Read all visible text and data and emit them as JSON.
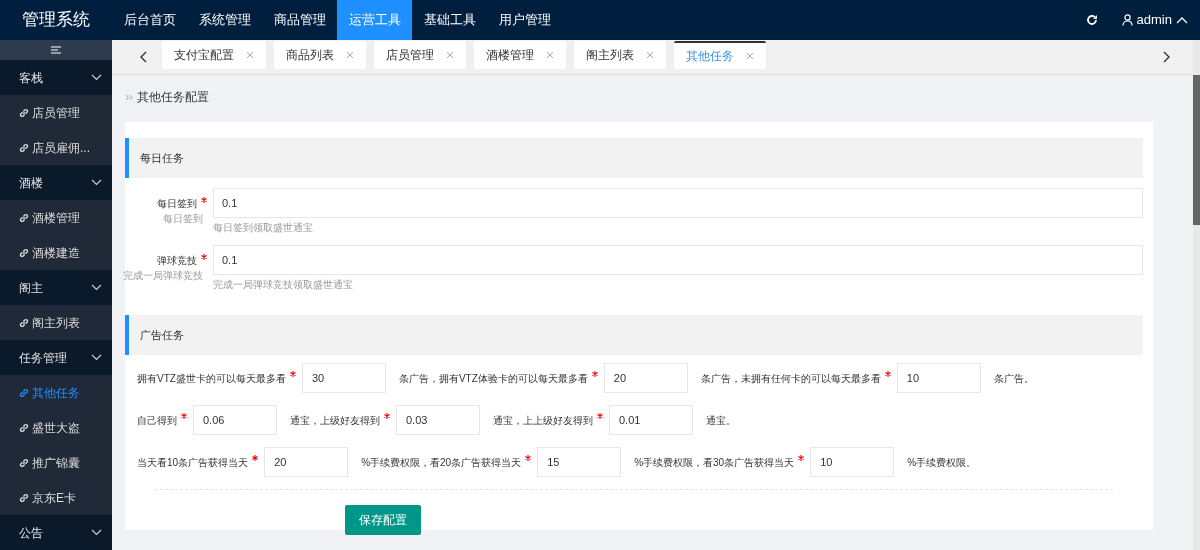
{
  "header": {
    "logo": "管理系统",
    "nav": [
      {
        "label": "后台首页",
        "selected": false
      },
      {
        "label": "系统管理",
        "selected": false
      },
      {
        "label": "商品管理",
        "selected": false
      },
      {
        "label": "运营工具",
        "selected": true
      },
      {
        "label": "基础工具",
        "selected": false
      },
      {
        "label": "用户管理",
        "selected": false
      }
    ],
    "user": "admin"
  },
  "sidebar": {
    "groups": [
      {
        "label": "客栈",
        "items": [
          {
            "label": "店员管理",
            "selected": false
          },
          {
            "label": "店员雇佣...",
            "selected": false
          }
        ]
      },
      {
        "label": "酒楼",
        "items": [
          {
            "label": "酒楼管理",
            "selected": false
          },
          {
            "label": "酒楼建造",
            "selected": false
          }
        ]
      },
      {
        "label": "阁主",
        "items": [
          {
            "label": "阁主列表",
            "selected": false
          }
        ]
      },
      {
        "label": "任务管理",
        "items": [
          {
            "label": "其他任务",
            "selected": true
          },
          {
            "label": "盛世大盗",
            "selected": false
          },
          {
            "label": "推广锦囊",
            "selected": false
          },
          {
            "label": "京东E卡",
            "selected": false
          }
        ]
      },
      {
        "label": "公告"
      }
    ]
  },
  "tabs": [
    {
      "label": "支付宝配置",
      "selected": false
    },
    {
      "label": "商品列表",
      "selected": false
    },
    {
      "label": "店员管理",
      "selected": false
    },
    {
      "label": "酒楼管理",
      "selected": false
    },
    {
      "label": "阁主列表",
      "selected": false
    },
    {
      "label": "其他任务",
      "selected": true
    }
  ],
  "breadcrumb": "其他任务配置",
  "daily": {
    "title": "每日任务",
    "fields": [
      {
        "label": "每日签到",
        "required": true,
        "sublabel": "每日签到",
        "value": "0.1",
        "help": "每日签到领取盛世通宝"
      },
      {
        "label": "弹球竞技",
        "required": true,
        "sublabel": "完成一局弹球竞技",
        "value": "0.1",
        "help": "完成一局弹球竞技领取盛世通宝"
      }
    ]
  },
  "ads": {
    "title": "广告任务",
    "lines": [
      {
        "fields": [
          {
            "label": "拥有VTZ盛世卡的可以每天最多看",
            "required": true,
            "value": "30"
          },
          {
            "label": "条广告，拥有VTZ体验卡的可以每天最多看",
            "required": true,
            "value": "20"
          },
          {
            "label": "条广告，未拥有任何卡的可以每天最多看",
            "required": true,
            "value": "10"
          }
        ],
        "suffix": "条广告。"
      },
      {
        "fields": [
          {
            "label": "自己得到",
            "required": true,
            "value": "0.06"
          },
          {
            "label": "通宝，上级好友得到",
            "required": true,
            "value": "0.03"
          },
          {
            "label": "通宝，上上级好友得到",
            "required": true,
            "value": "0.01"
          }
        ],
        "suffix": "通宝。"
      },
      {
        "fields": [
          {
            "label": "当天看10条广告获得当天",
            "required": true,
            "value": "20"
          },
          {
            "label": "%手续费权限，看20条广告获得当天",
            "required": true,
            "value": "15"
          },
          {
            "label": "%手续费权限，看30条广告获得当天",
            "required": true,
            "value": "10"
          }
        ],
        "suffix": "%手续费权限。"
      }
    ]
  },
  "save_button": "保存配置"
}
